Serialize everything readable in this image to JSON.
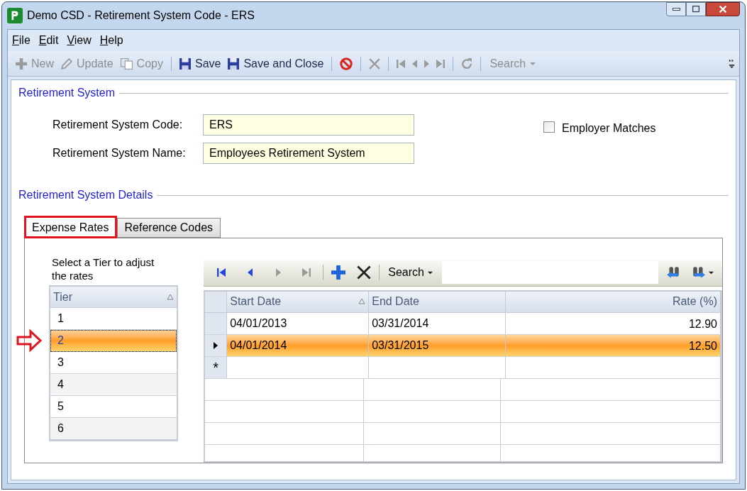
{
  "window": {
    "title": "Demo CSD - Retirement System Code - ERS"
  },
  "menu": [
    {
      "label": "File"
    },
    {
      "label": "Edit"
    },
    {
      "label": "View"
    },
    {
      "label": "Help"
    }
  ],
  "toolbar": [
    {
      "kind": "plus",
      "label": "New",
      "disabled": true
    },
    {
      "kind": "pencil",
      "label": "Update",
      "disabled": true
    },
    {
      "kind": "copy",
      "label": "Copy",
      "disabled": true
    },
    {
      "kind": "separator"
    },
    {
      "kind": "save",
      "label": "Save",
      "disabled": false
    },
    {
      "kind": "save",
      "label": "Save and Close",
      "disabled": false
    },
    {
      "kind": "separator"
    },
    {
      "kind": "cancel",
      "disabled": false
    },
    {
      "kind": "separator"
    },
    {
      "kind": "delete",
      "disabled": true
    },
    {
      "kind": "separator"
    },
    {
      "kind": "first",
      "disabled": true
    },
    {
      "kind": "prev",
      "disabled": true
    },
    {
      "kind": "next",
      "disabled": true
    },
    {
      "kind": "last",
      "disabled": true
    },
    {
      "kind": "separator"
    },
    {
      "kind": "refresh",
      "disabled": true
    },
    {
      "kind": "separator"
    },
    {
      "kind": "dropdown",
      "label": "Search",
      "disabled": true
    }
  ],
  "section_1": {
    "title": "Retirement System"
  },
  "fields": [
    {
      "label": "Retirement System Code:",
      "value": "ERS"
    },
    {
      "label": "Retirement System Name:",
      "value": "Employees Retirement System"
    }
  ],
  "employer_matches": {
    "label": "Employer Matches",
    "checked": false
  },
  "section_2": {
    "title": "Retirement System Details"
  },
  "tabs": [
    {
      "label": "Expense Rates",
      "selected": true,
      "annotated": true
    },
    {
      "label": "Reference Codes",
      "selected": false,
      "annotated": false
    }
  ],
  "tier_prompt": "Select a Tier to adjust the rates",
  "tier_table": {
    "column": "Tier",
    "rows": [
      {
        "tier": "1",
        "selected": false,
        "annotated": false
      },
      {
        "tier": "2",
        "selected": true,
        "annotated": true
      },
      {
        "tier": "3",
        "selected": false,
        "annotated": false
      },
      {
        "tier": "4",
        "selected": false,
        "annotated": false
      },
      {
        "tier": "5",
        "selected": false,
        "annotated": false
      },
      {
        "tier": "6",
        "selected": false,
        "annotated": false
      }
    ]
  },
  "grid_toolbar": {
    "search": "Search"
  },
  "rates_table": {
    "columns": [
      "Start Date",
      "End Date",
      "Rate (%)"
    ],
    "rows": [
      {
        "start_date": "04/01/2013",
        "end_date": "03/31/2014",
        "rate": "12.90",
        "selected": false
      },
      {
        "start_date": "04/01/2014",
        "end_date": "03/31/2015",
        "rate": "12.50",
        "selected": true
      }
    ],
    "new_row_marker": "*"
  }
}
